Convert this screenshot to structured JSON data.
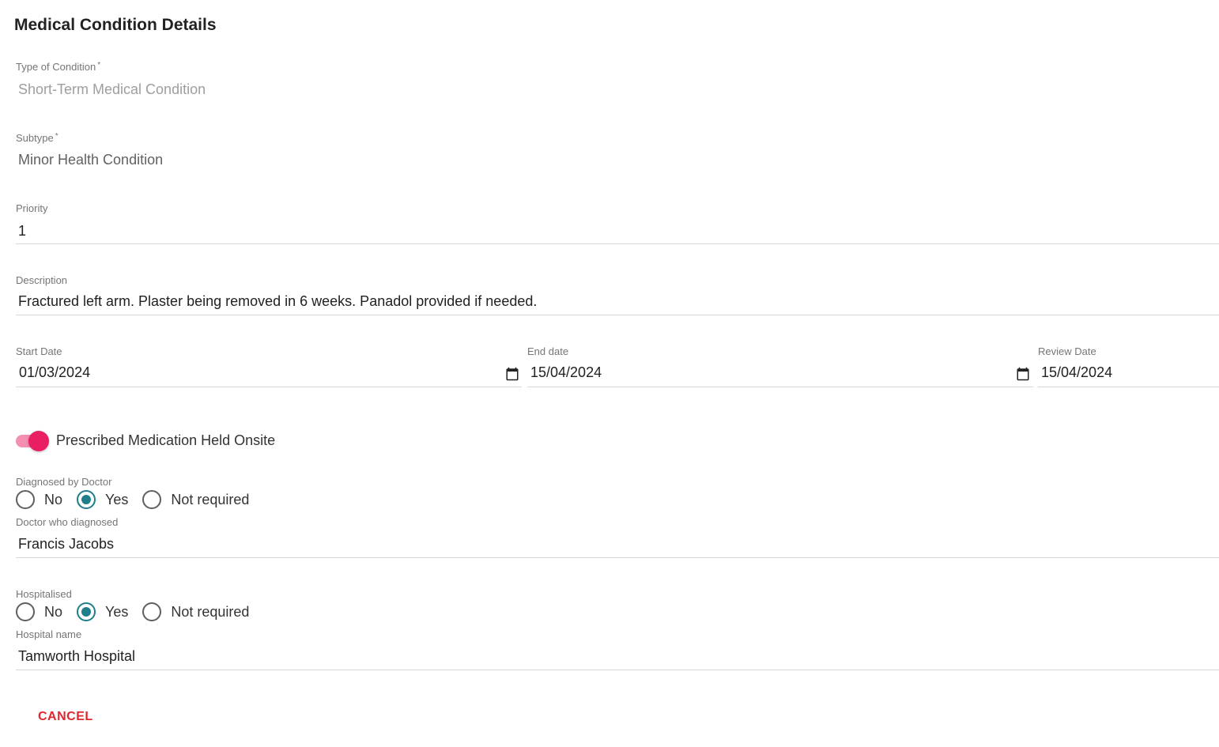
{
  "form": {
    "title": "Medical Condition Details",
    "type_of_condition": {
      "label": "Type of Condition",
      "required_mark": "*",
      "value": "Short-Term Medical Condition"
    },
    "subtype": {
      "label": "Subtype",
      "required_mark": "*",
      "value": "Minor Health Condition"
    },
    "priority": {
      "label": "Priority",
      "value": "1"
    },
    "description": {
      "label": "Description",
      "value": "Fractured left arm.  Plaster being removed in 6 weeks.  Panadol provided if needed."
    },
    "start_date": {
      "label": "Start Date",
      "value": "01/03/2024"
    },
    "end_date": {
      "label": "End date",
      "value": "15/04/2024"
    },
    "review_date": {
      "label": "Review Date",
      "value": "15/04/2024"
    },
    "medication_toggle": {
      "label": "Prescribed Medication Held Onsite",
      "on": true
    },
    "diagnosed_by_doctor": {
      "label": "Diagnosed by Doctor",
      "options": [
        "No",
        "Yes",
        "Not required"
      ],
      "selected": "Yes"
    },
    "doctor_name": {
      "label": "Doctor who diagnosed",
      "value": "Francis Jacobs"
    },
    "hospitalised": {
      "label": "Hospitalised",
      "options": [
        "No",
        "Yes",
        "Not required"
      ],
      "selected": "Yes"
    },
    "hospital_name": {
      "label": "Hospital name",
      "value": "Tamworth Hospital"
    },
    "cancel_label": "CANCEL"
  },
  "colors": {
    "accent_pink": "#e91e63",
    "radio_teal": "#1e7f8a",
    "cancel_red": "#e0282e"
  }
}
